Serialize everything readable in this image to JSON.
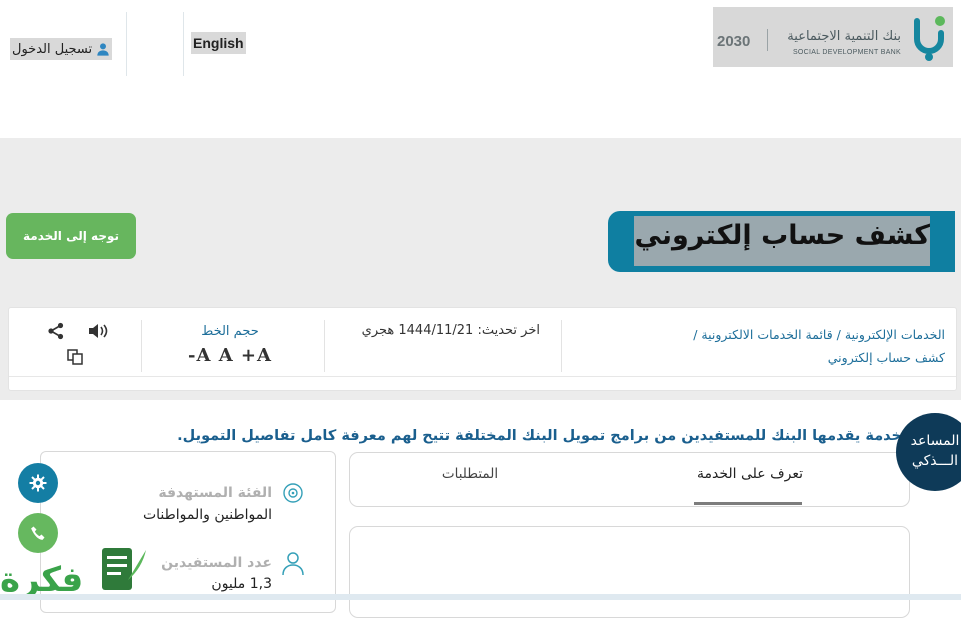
{
  "header": {
    "login_label": "تسجيل الدخول",
    "language_label": "English",
    "logo": {
      "name_ar": "بنك التنمية الاجتماعية",
      "name_en": "SOCIAL DEVELOPMENT BANK",
      "vision": "2030"
    }
  },
  "hero": {
    "title": "كشف حساب إلكتروني",
    "cta_label": "توجه إلى الخدمة"
  },
  "info": {
    "breadcrumb_line1": "الخدمات الإلكترونية / قائمة الخدمات الالكترونية /",
    "breadcrumb_line2": "كشف حساب إلكتروني",
    "last_update": "اخر تحديث: 1444/11/21 هجري",
    "font_size_label": "حجم الخط",
    "font_size_controls": "-A A +A",
    "icons": [
      "share-icon",
      "speaker-icon",
      "copy-icon"
    ]
  },
  "content": {
    "description": "خدمة يقدمها البنك للمستفيدين من برامج تمويل البنك المختلفة تتيح لهم معرفة كامل تفاصيل التمويل.",
    "tabs": [
      {
        "label": "تعرف على الخدمة",
        "active": true
      },
      {
        "label": "المتطلبات",
        "active": false
      }
    ],
    "target_label": "الفئة المستهدفة",
    "target_value": "المواطنين والمواطنات",
    "beneficiaries_label": "عدد المستفيدين",
    "beneficiaries_value": "1,3 مليون"
  },
  "assistant": {
    "line1": "المساعد",
    "line2": "الـــذكي"
  },
  "watermark": "فكرة",
  "colors": {
    "primary": "#0f7fa1",
    "cta": "#67b65e",
    "navy": "#0e3a58",
    "link": "#1d6e9a"
  }
}
